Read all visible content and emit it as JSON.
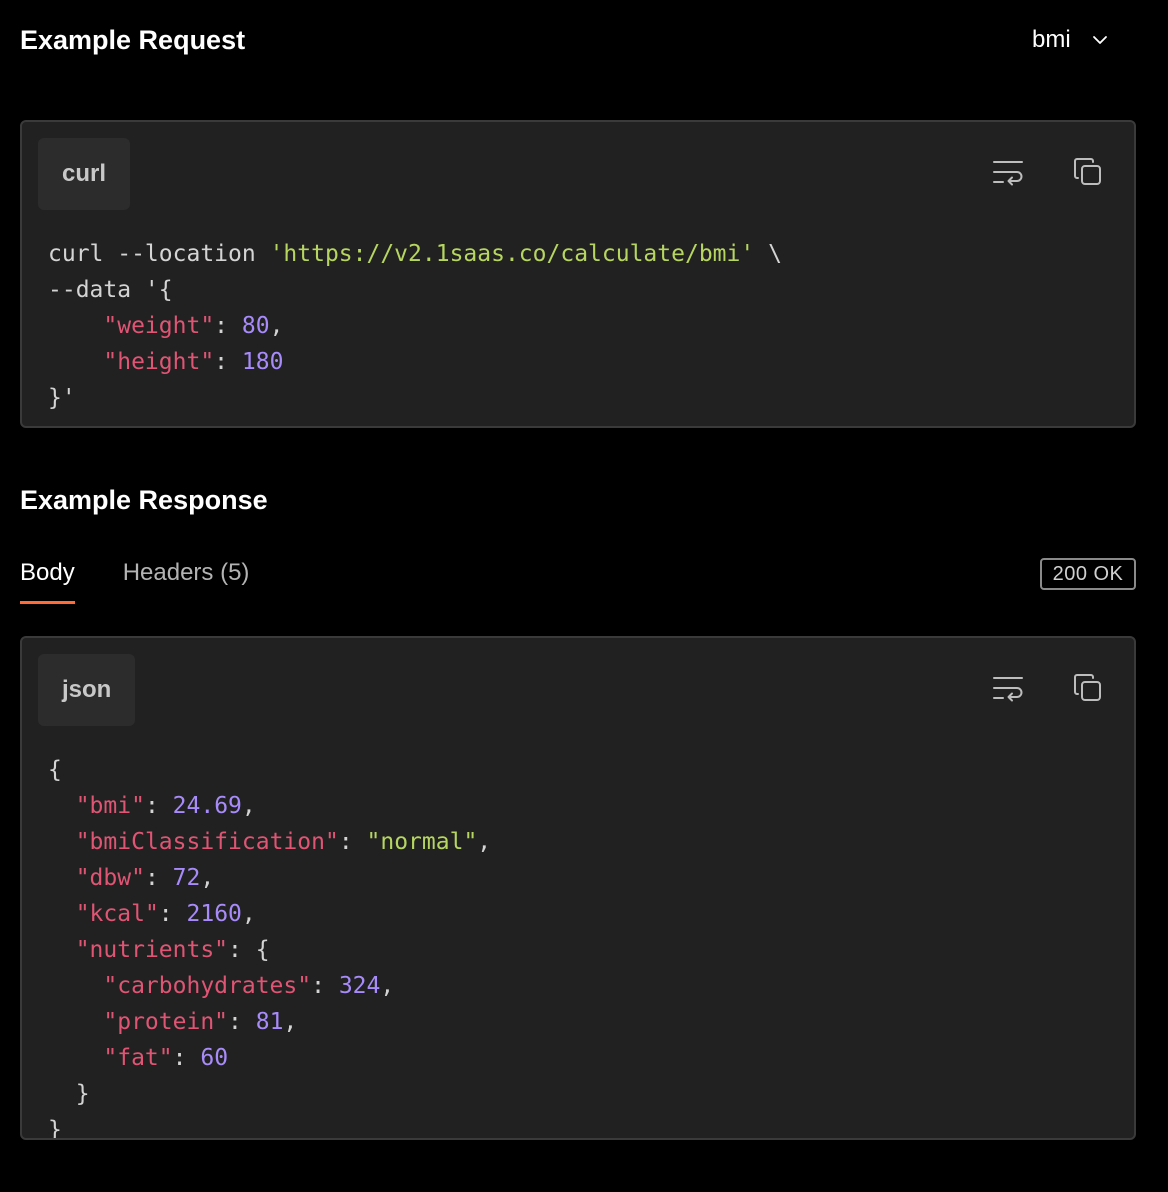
{
  "request": {
    "title": "Example Request",
    "example_select": {
      "value": "bmi",
      "icon": "chevron-down-icon"
    },
    "language": "curl",
    "code_lines": [
      [
        {
          "t": "curl --location ",
          "c": "plain"
        },
        {
          "t": "'https://v2.1saas.co/calculate/bmi'",
          "c": "str"
        },
        {
          "t": " \\",
          "c": "plain"
        }
      ],
      [
        {
          "t": "--data '{",
          "c": "plain"
        }
      ],
      [
        {
          "t": "    ",
          "c": "plain"
        },
        {
          "t": "\"weight\"",
          "c": "key"
        },
        {
          "t": ": ",
          "c": "punc"
        },
        {
          "t": "80",
          "c": "num"
        },
        {
          "t": ",",
          "c": "punc"
        }
      ],
      [
        {
          "t": "    ",
          "c": "plain"
        },
        {
          "t": "\"height\"",
          "c": "key"
        },
        {
          "t": ": ",
          "c": "punc"
        },
        {
          "t": "180",
          "c": "num"
        }
      ],
      [
        {
          "t": "}'",
          "c": "plain"
        }
      ]
    ]
  },
  "response": {
    "title": "Example Response",
    "tabs": [
      {
        "label": "Body",
        "active": true
      },
      {
        "label": "Headers (5)",
        "active": false
      }
    ],
    "status": "200 OK",
    "language": "json",
    "code_lines": [
      [
        {
          "t": "{",
          "c": "punc"
        }
      ],
      [
        {
          "t": "  ",
          "c": "plain"
        },
        {
          "t": "\"bmi\"",
          "c": "key"
        },
        {
          "t": ": ",
          "c": "punc"
        },
        {
          "t": "24.69",
          "c": "num"
        },
        {
          "t": ",",
          "c": "punc"
        }
      ],
      [
        {
          "t": "  ",
          "c": "plain"
        },
        {
          "t": "\"bmiClassification\"",
          "c": "key"
        },
        {
          "t": ": ",
          "c": "punc"
        },
        {
          "t": "\"normal\"",
          "c": "str"
        },
        {
          "t": ",",
          "c": "punc"
        }
      ],
      [
        {
          "t": "  ",
          "c": "plain"
        },
        {
          "t": "\"dbw\"",
          "c": "key"
        },
        {
          "t": ": ",
          "c": "punc"
        },
        {
          "t": "72",
          "c": "num"
        },
        {
          "t": ",",
          "c": "punc"
        }
      ],
      [
        {
          "t": "  ",
          "c": "plain"
        },
        {
          "t": "\"kcal\"",
          "c": "key"
        },
        {
          "t": ": ",
          "c": "punc"
        },
        {
          "t": "2160",
          "c": "num"
        },
        {
          "t": ",",
          "c": "punc"
        }
      ],
      [
        {
          "t": "  ",
          "c": "plain"
        },
        {
          "t": "\"nutrients\"",
          "c": "key"
        },
        {
          "t": ": {",
          "c": "punc"
        }
      ],
      [
        {
          "t": "    ",
          "c": "plain"
        },
        {
          "t": "\"carbohydrates\"",
          "c": "key"
        },
        {
          "t": ": ",
          "c": "punc"
        },
        {
          "t": "324",
          "c": "num"
        },
        {
          "t": ",",
          "c": "punc"
        }
      ],
      [
        {
          "t": "    ",
          "c": "plain"
        },
        {
          "t": "\"protein\"",
          "c": "key"
        },
        {
          "t": ": ",
          "c": "punc"
        },
        {
          "t": "81",
          "c": "num"
        },
        {
          "t": ",",
          "c": "punc"
        }
      ],
      [
        {
          "t": "    ",
          "c": "plain"
        },
        {
          "t": "\"fat\"",
          "c": "key"
        },
        {
          "t": ": ",
          "c": "punc"
        },
        {
          "t": "60",
          "c": "num"
        }
      ],
      [
        {
          "t": "  }",
          "c": "punc"
        }
      ],
      [
        {
          "t": "}",
          "c": "punc"
        }
      ]
    ]
  },
  "icons": {
    "wrap": "text-wrap-icon",
    "copy": "copy-icon"
  },
  "colors": {
    "accent": "#ff6c37",
    "string": "#b6d660",
    "key": "#e05474",
    "number": "#a78bfa",
    "panel_bg": "#212121"
  }
}
